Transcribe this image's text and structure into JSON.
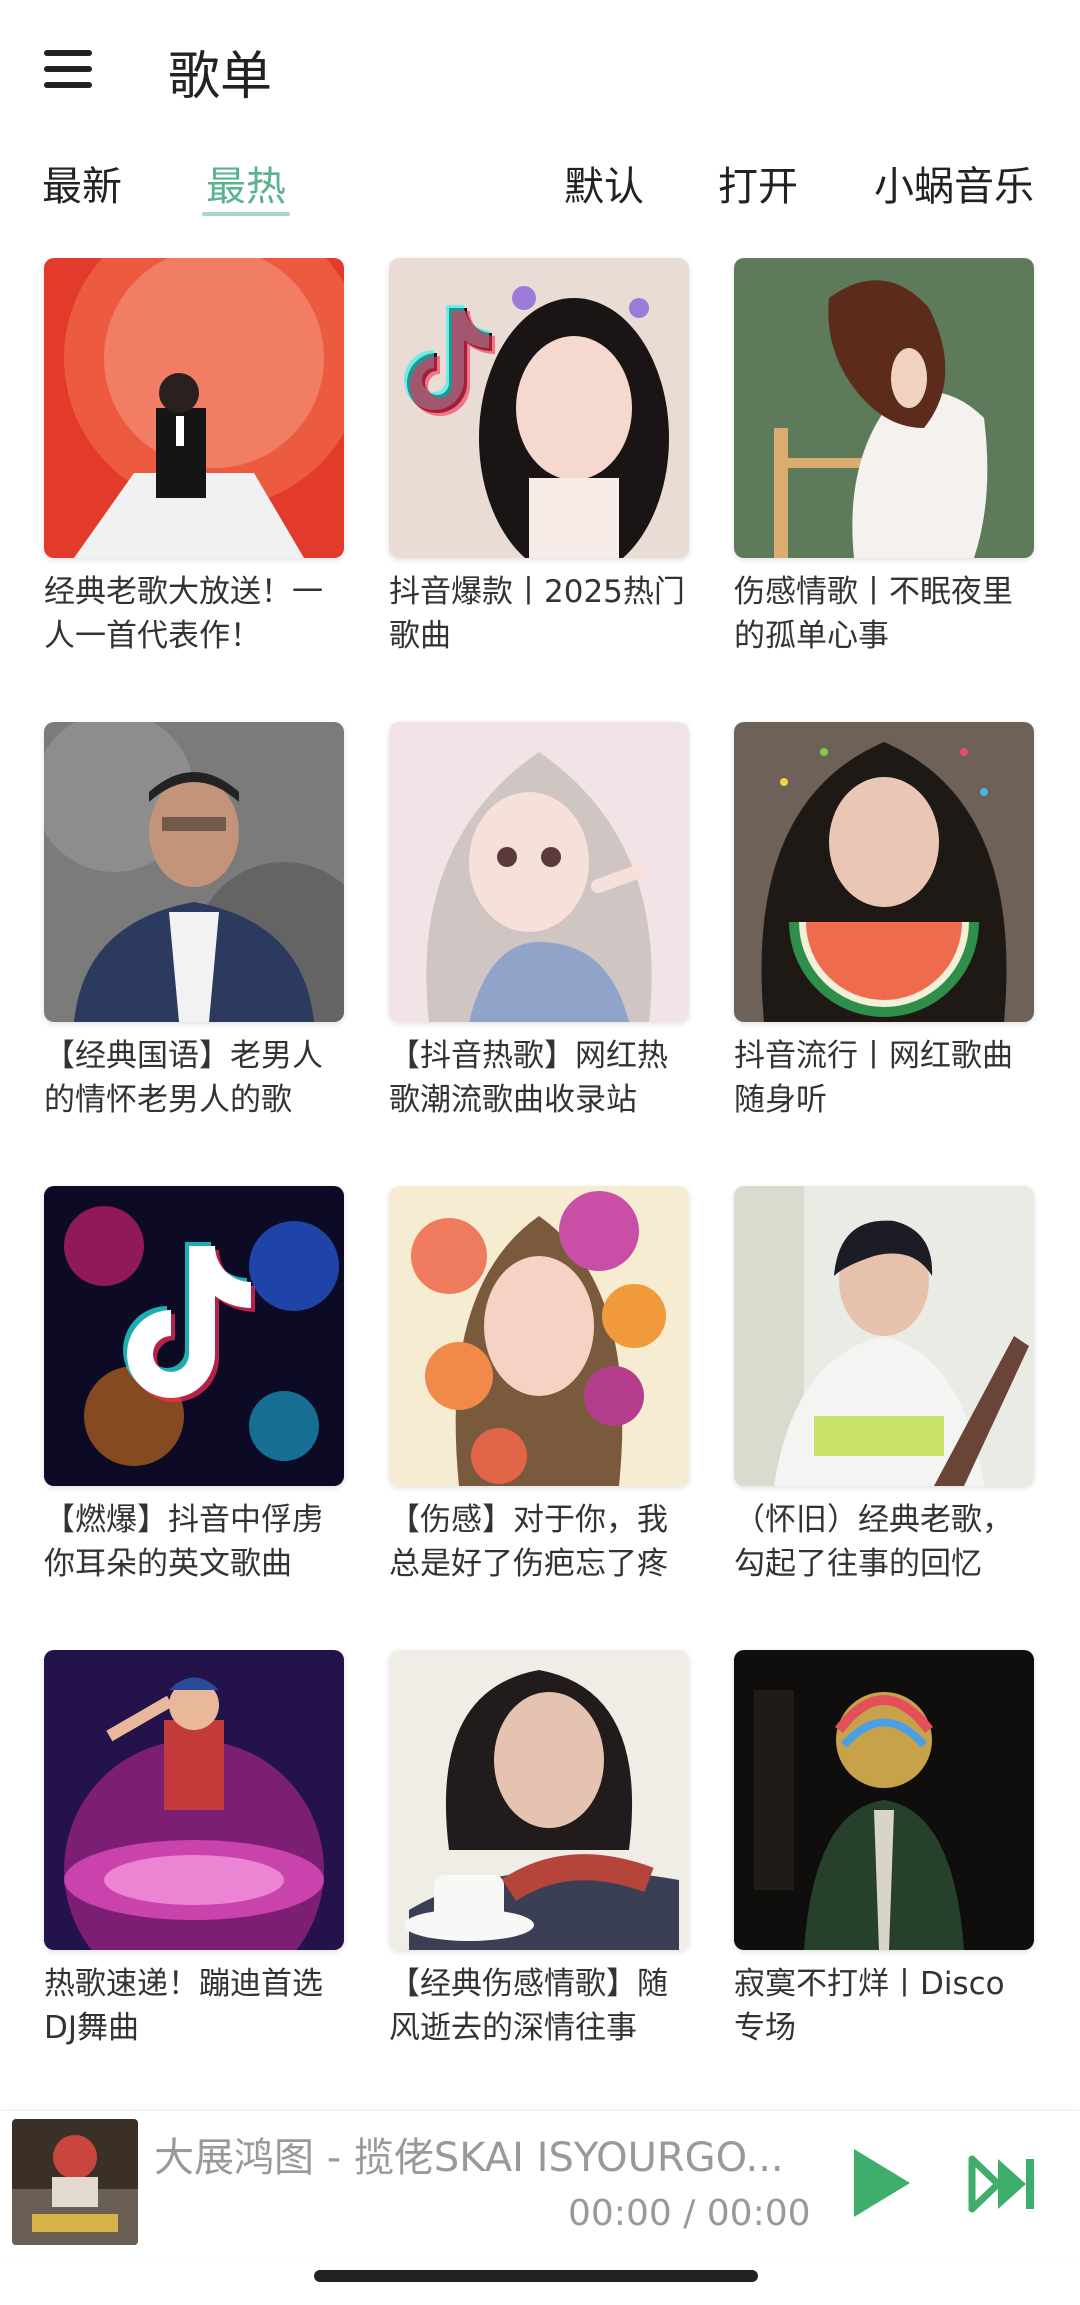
{
  "header": {
    "title": "歌单",
    "menu_icon": "menu-icon"
  },
  "tabs": [
    {
      "label": "最新"
    },
    {
      "label": "最热"
    }
  ],
  "actions": {
    "default_label": "默认",
    "open_label": "打开",
    "app_label": "小蜗音乐"
  },
  "colors": {
    "accent": "#5ab28e",
    "accent_light": "#a9d8c2",
    "play_green": "#3fae6d"
  },
  "playlists": [
    {
      "title": "经典老歌大放送！一人一首代表作！"
    },
    {
      "title": "抖音爆款丨2025热门歌曲"
    },
    {
      "title": "伤感情歌丨不眠夜里的孤单心事"
    },
    {
      "title": "【经典国语】老男人的情怀老男人的歌"
    },
    {
      "title": "【抖音热歌】网红热歌潮流歌曲收录站"
    },
    {
      "title": "抖音流行丨网红歌曲随身听"
    },
    {
      "title": "【燃爆】抖音中俘虏你耳朵的英文歌曲"
    },
    {
      "title": "【伤感】对于你，我总是好了伤疤忘了疼"
    },
    {
      "title": "（怀旧）经典老歌，勾起了往事的回忆"
    },
    {
      "title": "热歌速递！蹦迪首选DJ舞曲"
    },
    {
      "title": "【经典伤感情歌】随风逝去的深情往事"
    },
    {
      "title": "寂寞不打烊丨Disco专场"
    }
  ],
  "player": {
    "track": "大展鸿图 - 揽佬SKAI ISYOURGO...",
    "time": "00:00 / 00:00",
    "play_icon": "play-icon",
    "next_icon": "skip-next-icon"
  }
}
